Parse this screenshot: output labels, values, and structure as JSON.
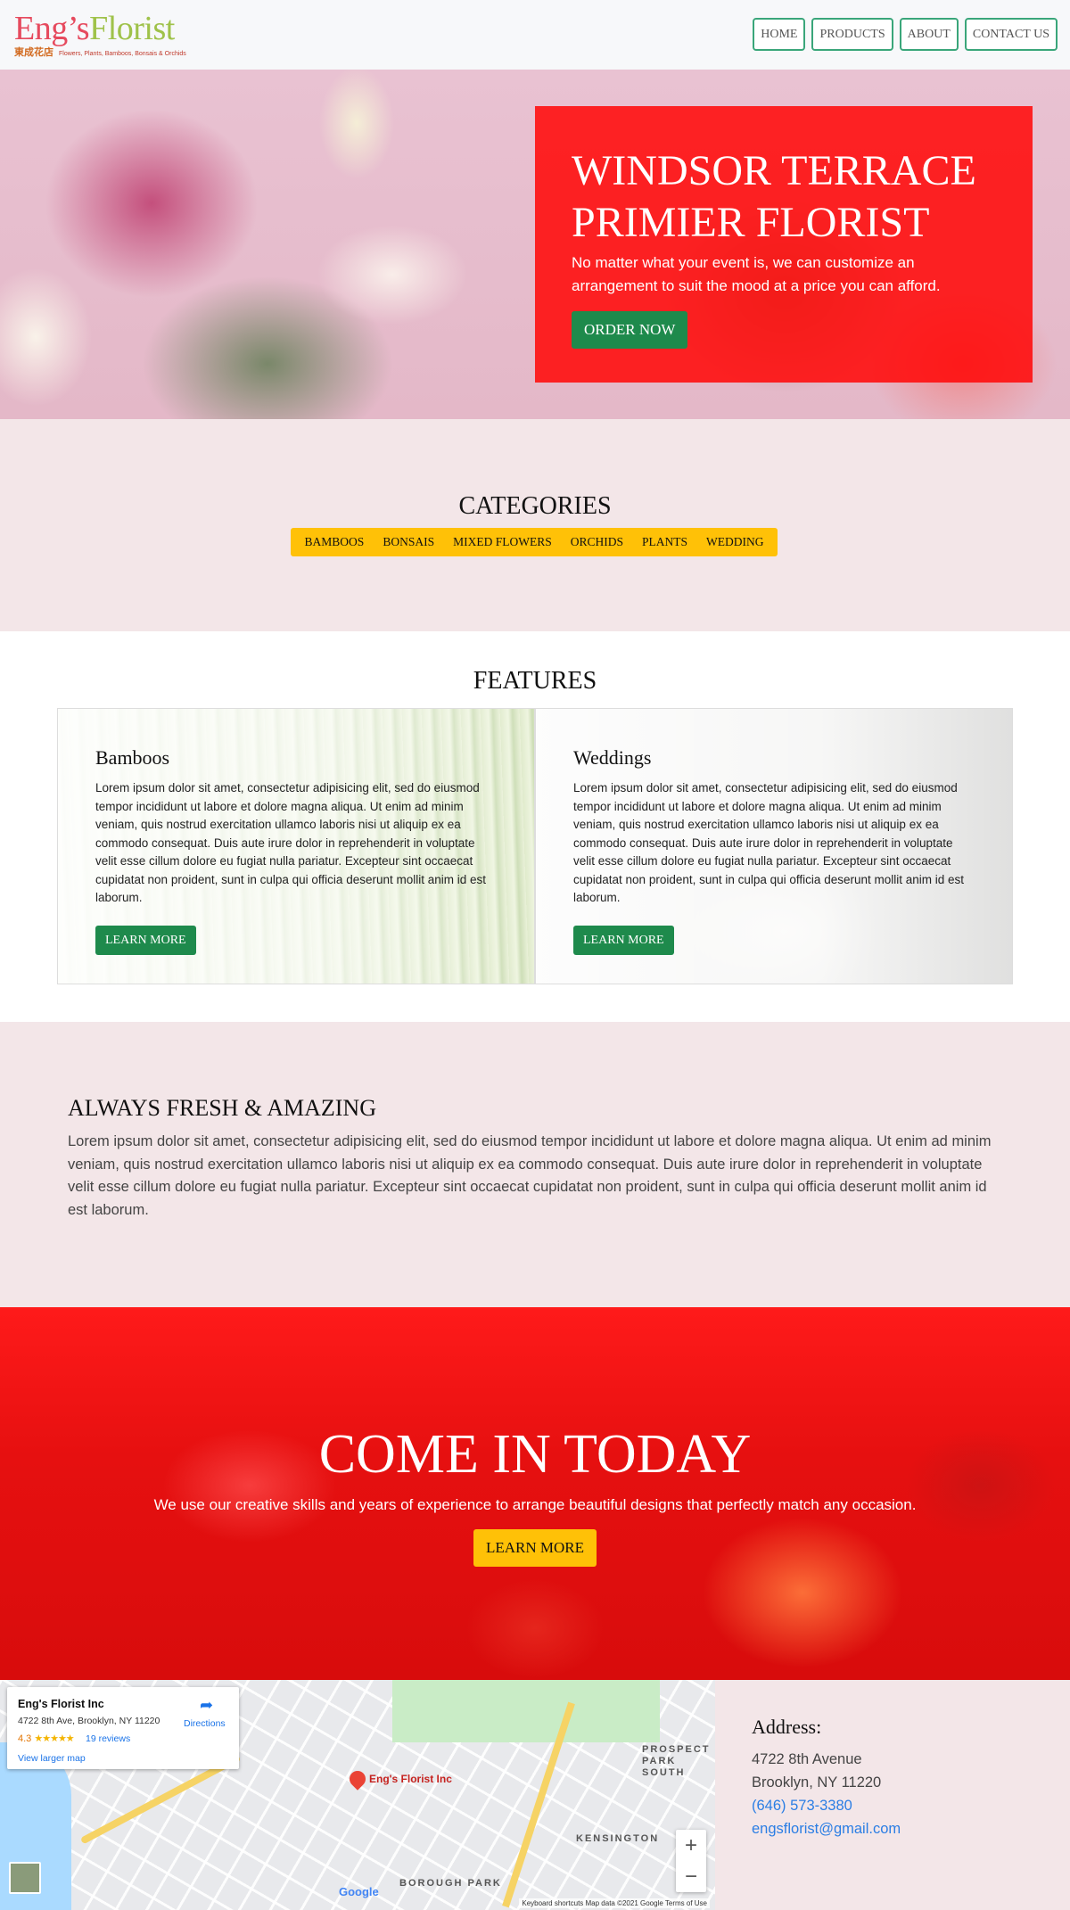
{
  "header": {
    "logo_part1": "Eng’s",
    "logo_part2": "Florist",
    "logo_chinese": "東成花店",
    "logo_tagline": "Flowers, Plants, Bamboos, Bonsais & Orchids",
    "nav": [
      "HOME",
      "PRODUCTS",
      "ABOUT",
      "CONTACT US"
    ]
  },
  "hero": {
    "title": "WINDSOR TERRACE PRIMIER FLORIST",
    "text": "No matter what your event is, we can customize an arrangement to suit the mood at a price you can afford.",
    "button": "ORDER NOW"
  },
  "categories": {
    "title": "CATEGORIES",
    "items": [
      "BAMBOOS",
      "BONSAIS",
      "MIXED FLOWERS",
      "ORCHIDS",
      "PLANTS",
      "WEDDING"
    ]
  },
  "features": {
    "title": "FEATURES",
    "cards": [
      {
        "title": "Bamboos",
        "text": "Lorem ipsum dolor sit amet, consectetur adipisicing elit, sed do eiusmod tempor incididunt ut labore et dolore magna aliqua. Ut enim ad minim veniam, quis nostrud exercitation ullamco laboris nisi ut aliquip ex ea commodo consequat. Duis aute irure dolor in reprehenderit in voluptate velit esse cillum dolore eu fugiat nulla pariatur. Excepteur sint occaecat cupidatat non proident, sunt in culpa qui officia deserunt mollit anim id est laborum.",
        "button": "LEARN MORE"
      },
      {
        "title": "Weddings",
        "text": "Lorem ipsum dolor sit amet, consectetur adipisicing elit, sed do eiusmod tempor incididunt ut labore et dolore magna aliqua. Ut enim ad minim veniam, quis nostrud exercitation ullamco laboris nisi ut aliquip ex ea commodo consequat. Duis aute irure dolor in reprehenderit in voluptate velit esse cillum dolore eu fugiat nulla pariatur. Excepteur sint occaecat cupidatat non proident, sunt in culpa qui officia deserunt mollit anim id est laborum.",
        "button": "LEARN MORE"
      }
    ]
  },
  "fresh": {
    "title": "ALWAYS FRESH & AMAZING",
    "text": "Lorem ipsum dolor sit amet, consectetur adipisicing elit, sed do eiusmod tempor incididunt ut labore et dolore magna aliqua. Ut enim ad minim veniam, quis nostrud exercitation ullamco laboris nisi ut aliquip ex ea commodo consequat. Duis aute irure dolor in reprehenderit in voluptate velit esse cillum dolore eu fugiat nulla pariatur. Excepteur sint occaecat cupidatat non proident, sunt in culpa qui officia deserunt mollit anim id est laborum."
  },
  "cta": {
    "title": "COME IN TODAY",
    "text": "We use our creative skills and years of experience to arrange beautiful designs that perfectly match any occasion.",
    "button": "LEARN MORE"
  },
  "map": {
    "place_name": "Eng's Florist Inc",
    "place_address": "4722 8th Ave, Brooklyn, NY 11220",
    "rating": "4.3",
    "stars": "★★★★★",
    "reviews": "19 reviews",
    "directions": "Directions",
    "view_larger": "View larger map",
    "pin_label": "Eng's Florist Inc",
    "zoom_in": "+",
    "zoom_out": "−",
    "google": "Google",
    "attribution": "Keyboard shortcuts   Map data ©2021 Google   Terms of Use",
    "labels": [
      "PROSPECT PARK SOUTH",
      "KENSINGTON",
      "BOROUGH PARK"
    ]
  },
  "address": {
    "title": "Address:",
    "street": "4722 8th Avenue",
    "city": "Brooklyn, NY 11220",
    "phone": "(646) 573-3380",
    "email": "engsflorist@gmail.com"
  },
  "colors": {
    "accent_green": "#1e8a4c",
    "accent_yellow": "#ffc107",
    "accent_red": "#ff0a0a",
    "section_pink": "#f3e6e8"
  }
}
